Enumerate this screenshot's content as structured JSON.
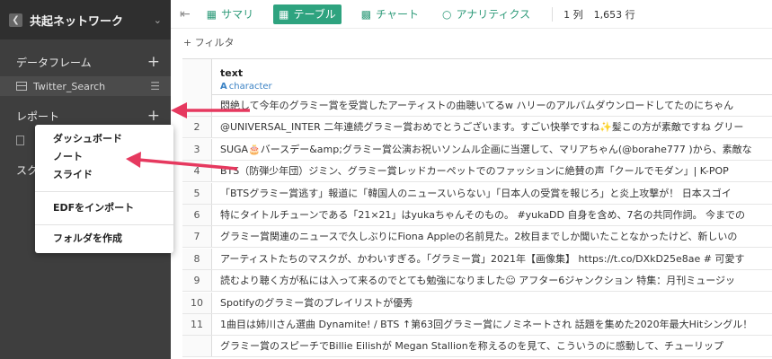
{
  "sidebar": {
    "project_title": "共起ネットワーク",
    "dataframes_label": "データフレーム",
    "dataframe_item": "Twitter_Search",
    "reports_label": "レポート",
    "scripts_label_partial": "スク"
  },
  "menu": {
    "items": [
      "ダッシュボード",
      "ノート",
      "スライド",
      "EDFをインポート",
      "フォルダを作成"
    ]
  },
  "toolbar": {
    "summary": "サマリ",
    "table": "テーブル",
    "chart": "チャート",
    "analytics": "アナリティクス",
    "cols": "1 列",
    "rows": "1,653 行"
  },
  "filter_label": "+ フィルタ",
  "table": {
    "column_name": "text",
    "column_type": "character",
    "rows": [
      {
        "n": "",
        "text": "悶絶して今年のグラミー賞を受賞したアーティストの曲聴いてるw ハリーのアルバムダウンロードしてたのにちゃん"
      },
      {
        "n": "2",
        "text": "@UNIVERSAL_INTER 二年連続グラミー賞おめでとうございます。すごい快挙ですね✨髪この方が素敵ですね グリー"
      },
      {
        "n": "3",
        "text": "SUGA🎂バースデー&amp;グラミー賞公演お祝いソンムル企画に当選して、マリアちゃん(@borahe777 )から、素敵な"
      },
      {
        "n": "4",
        "text": "BTS（防弾少年団）ジミン、グラミー賞レッドカーペットでのファッションに絶賛の声「クールでモダン」| K-POP"
      },
      {
        "n": "5",
        "text": "「BTSグラミー賞逃す」報道に「韓国人のニュースいらない」「日本人の受賞を報じろ」と炎上攻撃が！ 日本スゴイ"
      },
      {
        "n": "6",
        "text": "特にタイトルチューンである「21×21」はyukaちゃんそのもの。 #yukaDD 自身を含め、7名の共同作詞。 今までの"
      },
      {
        "n": "7",
        "text": "グラミー賞関連のニュースで久しぶりにFiona Appleの名前見た。2枚目までしか聞いたことなかったけど、新しいの"
      },
      {
        "n": "8",
        "text": "アーティストたちのマスクが、かわいすぎる。「グラミー賞」2021年【画像集】 https://t.co/DXkD25e8ae # 可愛す"
      },
      {
        "n": "9",
        "text": "読むより聴く方が私には入って来るのでとても勉強になりました☺ アフター6ジャンクション 特集：月刊ミュージッ"
      },
      {
        "n": "10",
        "text": "Spotifyのグラミー賞のプレイリストが優秀"
      },
      {
        "n": "11",
        "text": "1曲目は姉川さん選曲 Dynamite! / BTS ↑第63回グラミー賞にノミネートされ 話題を集めた2020年最大Hitシングル！"
      },
      {
        "n": "",
        "text": "グラミー賞のスピーチでBillie Eilishが Megan Stallionを称えるのを見て、こういうのに感動して、チューリップ"
      }
    ]
  },
  "colors": {
    "sidebar_bg": "#3e3e3e",
    "accent_green": "#2ea37f",
    "arrow_pink": "#e6395f",
    "type_blue": "#3b82c4"
  }
}
